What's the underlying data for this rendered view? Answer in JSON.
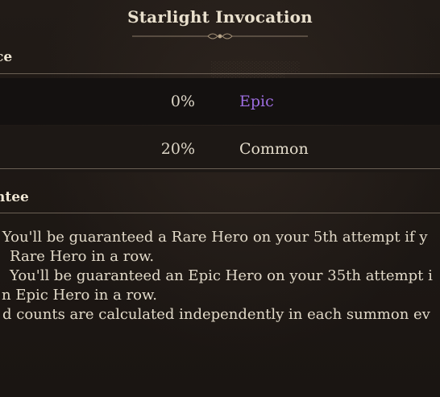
{
  "window": {
    "title": "Starlight Invocation"
  },
  "sections": {
    "rates_header": "ce",
    "guarantee_header": "ntee"
  },
  "rates": [
    {
      "percent": "0%",
      "grade": "Epic",
      "grade_color": "#9d6de0"
    },
    {
      "percent": "20%",
      "grade": "Common",
      "grade_color": "#e4dccb"
    }
  ],
  "guarantee_lines": [
    ": You'll be guaranteed a Rare Hero on your 5th attempt if y",
    "Rare Hero in a row.",
    "You'll be guaranteed an Epic Hero on your 35th attempt i",
    "n Epic Hero in a row.",
    "d counts are calculated independently in each summon ev"
  ]
}
